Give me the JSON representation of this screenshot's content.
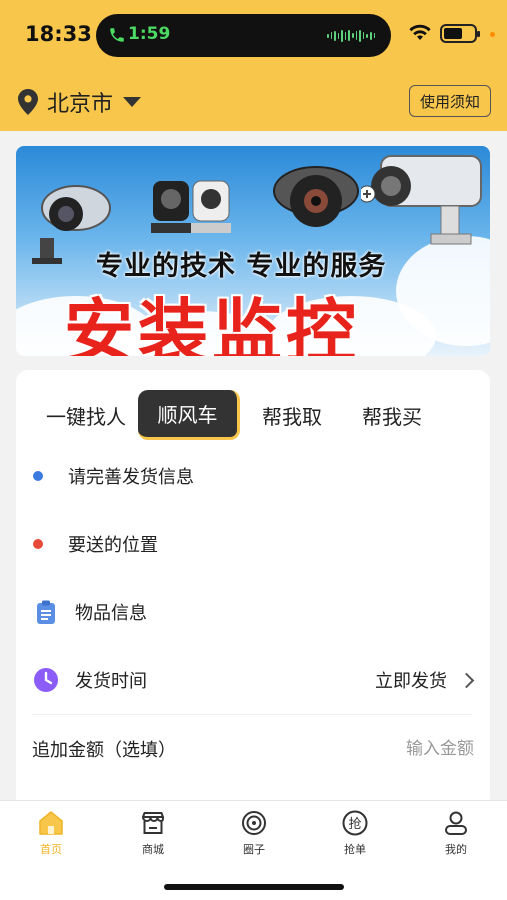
{
  "status_bar": {
    "time": "18:33",
    "call_time": "1:59"
  },
  "header": {
    "city": "北京市",
    "notice_button": "使用须知"
  },
  "banner": {
    "line1": "专业的技术 专业的服务",
    "line2": "安装监控"
  },
  "tabs": [
    {
      "label": "一键找人",
      "active": false
    },
    {
      "label": "顺风车",
      "active": true
    },
    {
      "label": "帮我取",
      "active": false
    },
    {
      "label": "帮我买",
      "active": false
    }
  ],
  "form": {
    "sender_info": "请完善发货信息",
    "destination": "要送的位置",
    "item_info": "物品信息",
    "ship_time_label": "发货时间",
    "ship_time_value": "立即发货",
    "extra_amount_label": "追加金额（选填）",
    "extra_amount_placeholder": "输入金额"
  },
  "bottom_nav": [
    {
      "label": "首页",
      "icon": "home-icon",
      "active": true
    },
    {
      "label": "商城",
      "icon": "store-icon",
      "active": false
    },
    {
      "label": "圈子",
      "icon": "circle-icon",
      "active": false
    },
    {
      "label": "抢单",
      "icon": "grab-order-icon",
      "active": false
    },
    {
      "label": "我的",
      "icon": "user-icon",
      "active": false
    }
  ],
  "colors": {
    "accent": "#f7c64a",
    "active_tab_bg": "#333333",
    "dot_blue": "#3b7be0",
    "dot_red": "#e84a3a",
    "clock_purple": "#8b5cf6",
    "clipboard_blue": "#5b8fe6"
  }
}
